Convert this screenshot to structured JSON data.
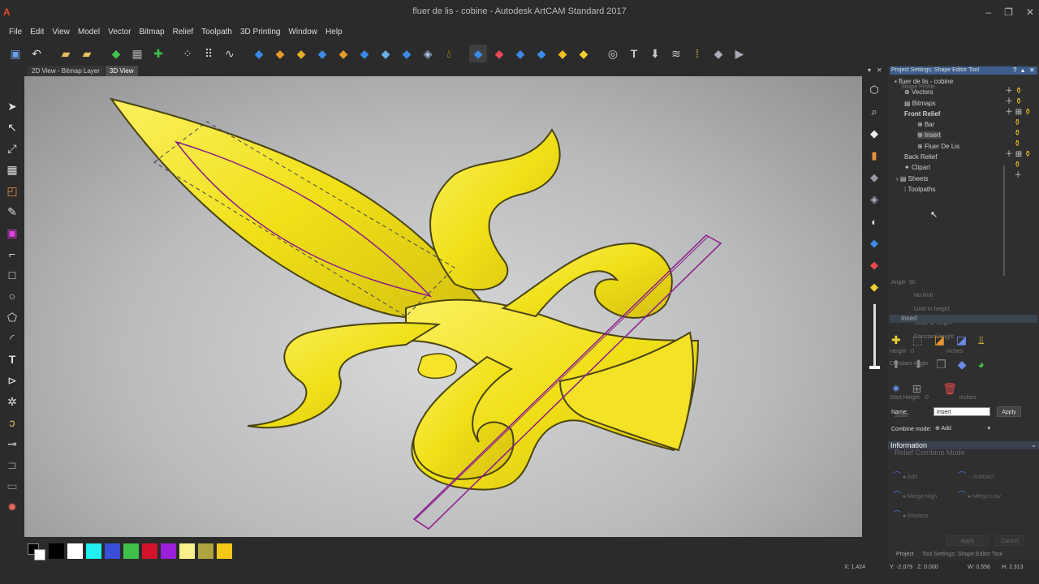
{
  "window": {
    "title": "fluer de lis - cobine - Autodesk ArtCAM Standard 2017",
    "app_icon": "A",
    "minimize": "–",
    "maximize": "❐",
    "close": "✕"
  },
  "menu": [
    "File",
    "Edit",
    "View",
    "Model",
    "Vector",
    "Bitmap",
    "Relief",
    "Toolpath",
    "3D Printing",
    "Window",
    "Help"
  ],
  "view_tabs": {
    "tab_2d": "2D View - Bitmap Layer",
    "tab_3d": "3D View"
  },
  "panel": {
    "header": "Project Settings: Shape Editor Tool",
    "tree": {
      "root": "fluer de lis - cobine",
      "vectors": "Vectors",
      "bitmaps": "Bitmaps",
      "front_relief": "Front Relief",
      "bar": "Bar",
      "insert": "Insert",
      "fluer_de_lis": "Fluer De Lis",
      "back_relief": "Back Relief",
      "clipart": "Clipart",
      "sheets": "Sheets",
      "toolpaths": "Toolpaths"
    },
    "ghost": {
      "shape_profile": "Shape Profile",
      "angle": "Angle",
      "angle_value": "90",
      "no_limit": "No limit",
      "limit_height": "Limit to height",
      "scale_height": "Scale to height",
      "constant_height": "Constant height",
      "insert_hdr": "Insert",
      "height": "Height",
      "height_value": "0",
      "constant_angle": "Constant Angle",
      "inches": "inches",
      "start_height": "Start Height",
      "start_height_value": "0",
      "inches2": "inches",
      "scale": "Scale"
    },
    "name_label": "Name:",
    "name_value": "Insert",
    "apply": "Apply",
    "combine_label": "Combine mode:",
    "combine_value": "Add",
    "information": "Information",
    "relief_combine_mode": "Relief Combine Mode",
    "modes": {
      "add": "Add",
      "subtract": "Subtract",
      "merge_high": "Merge High",
      "merge_low": "Merge Low",
      "replace": "Replace"
    },
    "apply_bottom": "Apply",
    "cancel_bottom": "Cancel",
    "bottom_tab_project": "Project",
    "bottom_tab_tools": "Tool Settings: Shape Editor Tool"
  },
  "status": {
    "x": "X: 1.424",
    "y": "Y: -2.079",
    "z": "Z: 0.000",
    "w": "W: 0.556",
    "h": "H: 2.313"
  },
  "palette": [
    "#000000",
    "#ffffff",
    "#22f0f0",
    "#3a4fd8",
    "#3fc04a",
    "#d2142a",
    "#9a1fd8",
    "#f8f08a",
    "#b0a440",
    "#f2c818"
  ],
  "colors": {
    "relief_gold": "#f0e018",
    "selection_purple": "#8a1a8a",
    "viewport_bg": "#c4c5c7"
  }
}
